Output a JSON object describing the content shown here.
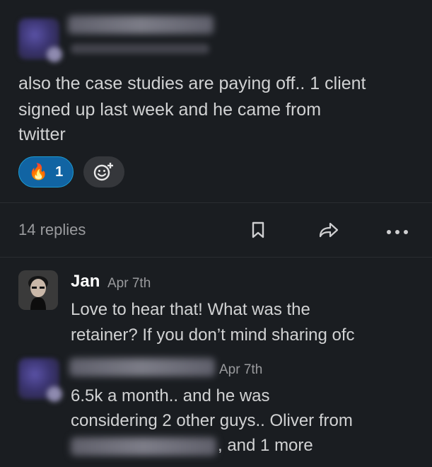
{
  "original_message": {
    "text": "also the case studies are paying off.. 1 client signed up last week and he came from twitter",
    "line1": "also the case studies are paying off.. 1 client",
    "line2": "signed up last week and he came from",
    "line3": "twitter",
    "reaction": {
      "emoji": "🔥",
      "count": "1"
    }
  },
  "thread_bar": {
    "replies_label": "14 replies"
  },
  "replies": [
    {
      "author": "Jan",
      "time": "Apr 7th",
      "line1": "Love to hear that! What was the",
      "line2": "retainer? If you don’t mind sharing ofc"
    },
    {
      "time": "Apr 7th",
      "line1": "6.5k a month.. and he was",
      "line2": "considering 2 other guys.. Oliver from",
      "line3_tail": ", and 1 more"
    }
  ],
  "icons": {
    "bookmark": "bookmark-icon",
    "share": "share-icon",
    "more": "more-icon",
    "add_reaction": "add-reaction-icon"
  }
}
